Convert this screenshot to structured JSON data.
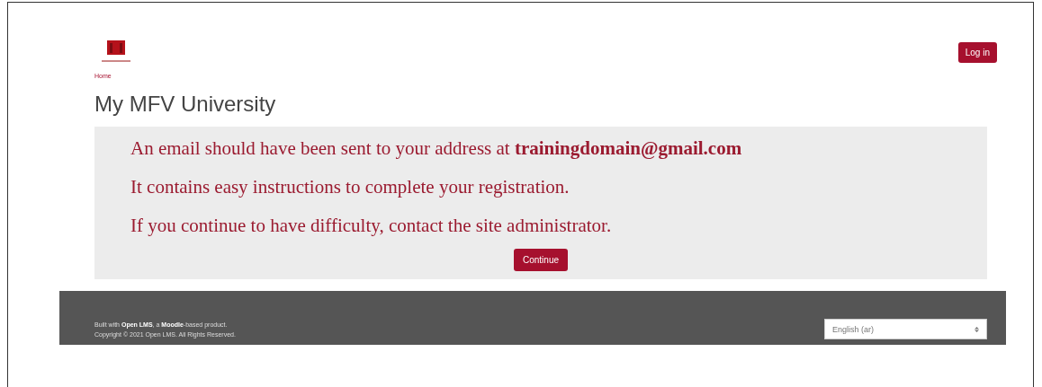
{
  "header": {
    "login_button": "Log in"
  },
  "breadcrumb": "Home",
  "page_title": "My MFV University",
  "notice": {
    "lines": [
      "An email should have been sent to your address at **trainingdomain@gmail.com**",
      "It contains easy instructions to complete your registration.",
      "If you continue to have difficulty, contact the site administrator."
    ],
    "button": "Continue"
  },
  "footer": {
    "lines": [
      "Built with **Open LMS**, a **Moodle**-based product.",
      "Copyright © 2021 Open LMS. All Rights Reserved."
    ],
    "language_select": "English (ar)"
  }
}
